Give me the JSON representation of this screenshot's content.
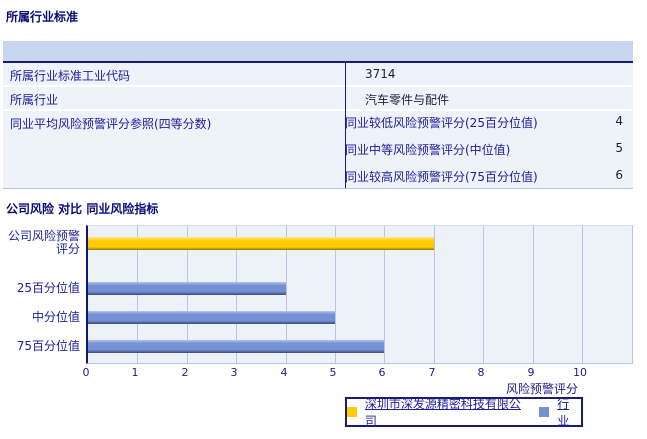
{
  "section1": {
    "title": "所属行业标准",
    "rows": [
      {
        "label": "所属行业标准工业代码",
        "value": "3714"
      },
      {
        "label": "所属行业",
        "value": "汽车零件与配件"
      },
      {
        "label": "同业平均风险预警评分参照(四等分数)",
        "subrows": [
          {
            "label": "同业较低风险预警评分(25百分位值)",
            "value": "4"
          },
          {
            "label": "同业中等风险预警评分(中位值)",
            "value": "5"
          },
          {
            "label": "同业较高风险预警评分(75百分位值)",
            "value": "6"
          }
        ]
      }
    ]
  },
  "section2": {
    "title": "公司风险 对比 同业风险指标"
  },
  "chart_data": {
    "type": "bar",
    "orientation": "horizontal",
    "title": "",
    "categories": [
      "公司风险预警评分",
      "25百分位值",
      "中分位值",
      "75百分位值"
    ],
    "values": [
      7,
      4,
      5,
      6
    ],
    "bar_series": [
      "company",
      "industry",
      "industry",
      "industry"
    ],
    "series": [
      {
        "name": "深圳市深发源精密科技有限公司",
        "key": "company",
        "color": "#ffcc00",
        "values": [
          7
        ]
      },
      {
        "name": "行业",
        "key": "industry",
        "color": "#7590d4",
        "values": [
          4,
          5,
          6
        ]
      }
    ],
    "xlabel": "风险预警评分",
    "x_ticks": [
      0,
      1,
      2,
      3,
      4,
      5,
      6,
      7,
      8,
      9,
      10
    ],
    "xlim": [
      0,
      11
    ],
    "grid": true,
    "legend_position": "bottom",
    "colors": {
      "company_bar": "#ffcc00",
      "industry_bar": "#7590d4",
      "plot_bg": "#edf1f8",
      "gridline": "#b5c5e4",
      "axis": "#16166b"
    },
    "legend": [
      {
        "label": "深圳市深发源精密科技有限公司",
        "key": "company"
      },
      {
        "label": "行业",
        "key": "industry"
      }
    ]
  }
}
